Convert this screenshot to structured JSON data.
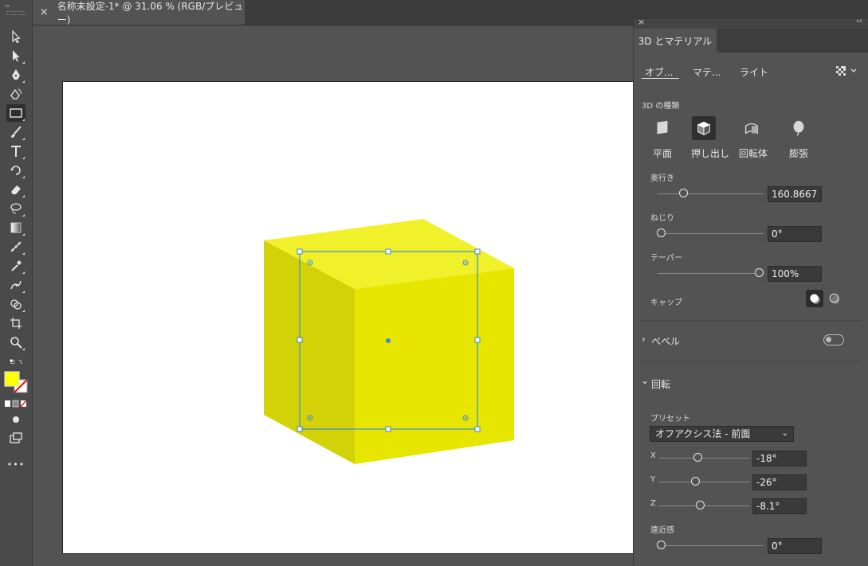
{
  "document": {
    "tab_title": "名称未設定-1* @ 31.06 % (RGB/プレビュー)",
    "close_glyph": "×"
  },
  "toolbar": {
    "tools": [
      "selection-tool",
      "direct-selection-tool",
      "pen-tool",
      "curvature-tool",
      "rectangle-tool",
      "paintbrush-tool",
      "type-tool",
      "rotate-tool",
      "eraser-tool",
      "lasso-tool",
      "gradient-tool",
      "blend-tool",
      "eyedropper-tool",
      "puppet-warp-tool",
      "shape-builder-tool",
      "artboard-tool",
      "zoom-tool"
    ],
    "fill_color": "#ffff00",
    "more_glyph": "•••"
  },
  "panel": {
    "title": "3D とマテリアル",
    "close_glyph": "×",
    "collapse_glyph": "‹‹",
    "tabs": [
      "オブ...",
      "マテ...",
      "ライト"
    ],
    "type_label": "3D の種類",
    "types": [
      "平面",
      "押し出し",
      "回転体",
      "膨張"
    ],
    "selected_type": "押し出し",
    "depth": {
      "label": "奥行き",
      "value": "160.8667"
    },
    "twist": {
      "label": "ねじり",
      "value": "0°"
    },
    "taper": {
      "label": "テーパー",
      "value": "100%"
    },
    "cap": {
      "label": "キャップ"
    },
    "bevel": {
      "label": "ベベル",
      "chevron": "›",
      "enabled": false
    },
    "rotation": {
      "label": "回転",
      "chevron": "⌄",
      "preset_label": "プリセット",
      "preset_value": "オフアクシス法 - 前面",
      "x": {
        "label": "X",
        "value": "-18°"
      },
      "y": {
        "label": "Y",
        "value": "-26°"
      },
      "z": {
        "label": "Z",
        "value": "-8.1°"
      },
      "perspective": {
        "label": "遠近感",
        "value": "0°"
      }
    }
  },
  "colors": {
    "cube_front": "#e6e600",
    "cube_top": "#f2f22a",
    "cube_side": "#d4d408",
    "selection": "#3d8bd6"
  }
}
